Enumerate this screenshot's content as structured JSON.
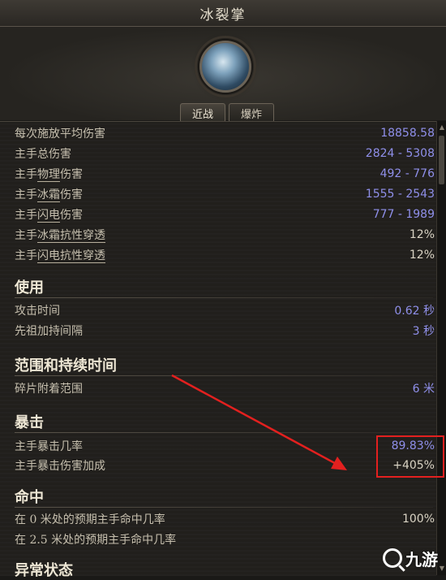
{
  "window": {
    "title": "冰裂掌"
  },
  "skill": {
    "icon": "ice-crack-palm-icon"
  },
  "tabs": [
    {
      "label": "近战",
      "active": true
    },
    {
      "label": "爆炸",
      "active": false
    }
  ],
  "damage": [
    {
      "label": "每次施放平均伤害",
      "value": "18858.58"
    },
    {
      "label": "主手总伤害",
      "value": "2824 - 5308"
    },
    {
      "label": "主手物理伤害",
      "underline": "物理",
      "value": "492 - 776"
    },
    {
      "label": "主手冰霜伤害",
      "underline": "冰霜",
      "value": "1555 - 2543"
    },
    {
      "label": "主手闪电伤害",
      "underline": "闪电",
      "value": "777 - 1989"
    },
    {
      "label": "主手冰霜抗性穿透",
      "underline": "冰霜抗性穿透",
      "value": "12%"
    },
    {
      "label": "主手闪电抗性穿透",
      "underline": "闪电抗性穿透",
      "value": "12%"
    }
  ],
  "usage": {
    "title": "使用",
    "rows": [
      {
        "label": "攻击时间",
        "value": "0.62 秒"
      },
      {
        "label": "先祖加持间隔",
        "value": "3 秒"
      }
    ]
  },
  "area": {
    "title": "范围和持续时间",
    "rows": [
      {
        "label": "碎片附着范围",
        "value": "6 米"
      }
    ]
  },
  "crit": {
    "title": "暴击",
    "rows": [
      {
        "label": "主手暴击几率",
        "value": "89.83%"
      },
      {
        "label": "主手暴击伤害加成",
        "value": "+405%"
      }
    ]
  },
  "hit": {
    "title": "命中",
    "rows": [
      {
        "label": "在 0 米处的预期主手命中几率",
        "value": "100%"
      },
      {
        "label": "在 2.5 米处的预期主手命中几率",
        "value": ""
      }
    ]
  },
  "next_section": {
    "title": "异常状态"
  },
  "annotation": {
    "color": "#e3201f"
  },
  "watermark": {
    "text": "九游"
  }
}
